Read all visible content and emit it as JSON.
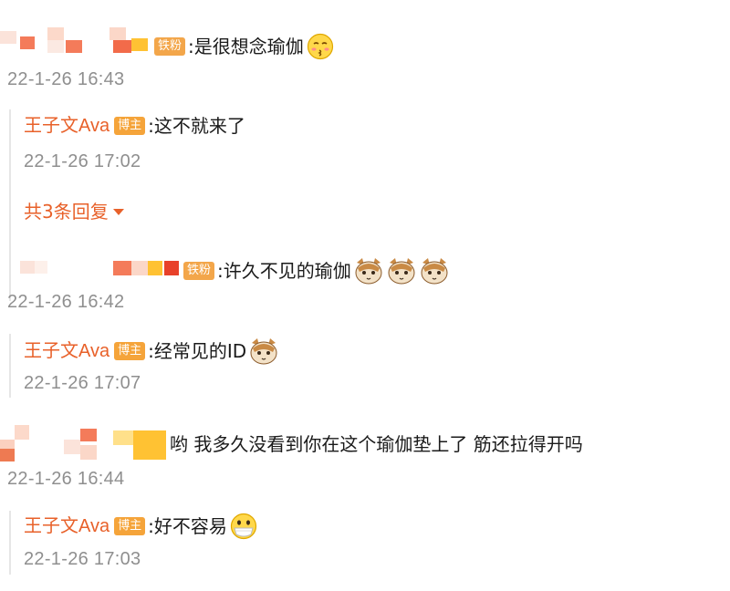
{
  "comments": [
    {
      "badge": "铁粉",
      "text": ":是很想念瑜伽",
      "emoji": "kiss-emoji",
      "time": "22-1-26 16:43",
      "reply": {
        "author": "王子文Ava",
        "badge": "博主",
        "text": ":这不就来了",
        "time": "22-1-26 17:02"
      },
      "more_label": "共3条回复"
    },
    {
      "badge": "铁粉",
      "text": ":许久不见的瑜伽",
      "emoji": "cat-sticker",
      "time": "22-1-26 16:42",
      "reply": {
        "author": "王子文Ava",
        "badge": "博主",
        "text": ":经常见的ID",
        "time": "22-1-26 17:07"
      }
    },
    {
      "text": "哟 我多久没看到你在这个瑜伽垫上了 筋还拉得开吗",
      "time": "22-1-26 16:44",
      "reply": {
        "author": "王子文Ava",
        "badge": "博主",
        "text": ":好不容易",
        "time": "22-1-26 17:03"
      }
    }
  ],
  "colors": {
    "author": "#e8612a",
    "timestamp": "#8f8f8f",
    "badge": "#f5a43a",
    "mosaic_orange": "#ee7a52",
    "mosaic_pink": "#fbd9cc",
    "mosaic_yellow": "#ffc233"
  }
}
